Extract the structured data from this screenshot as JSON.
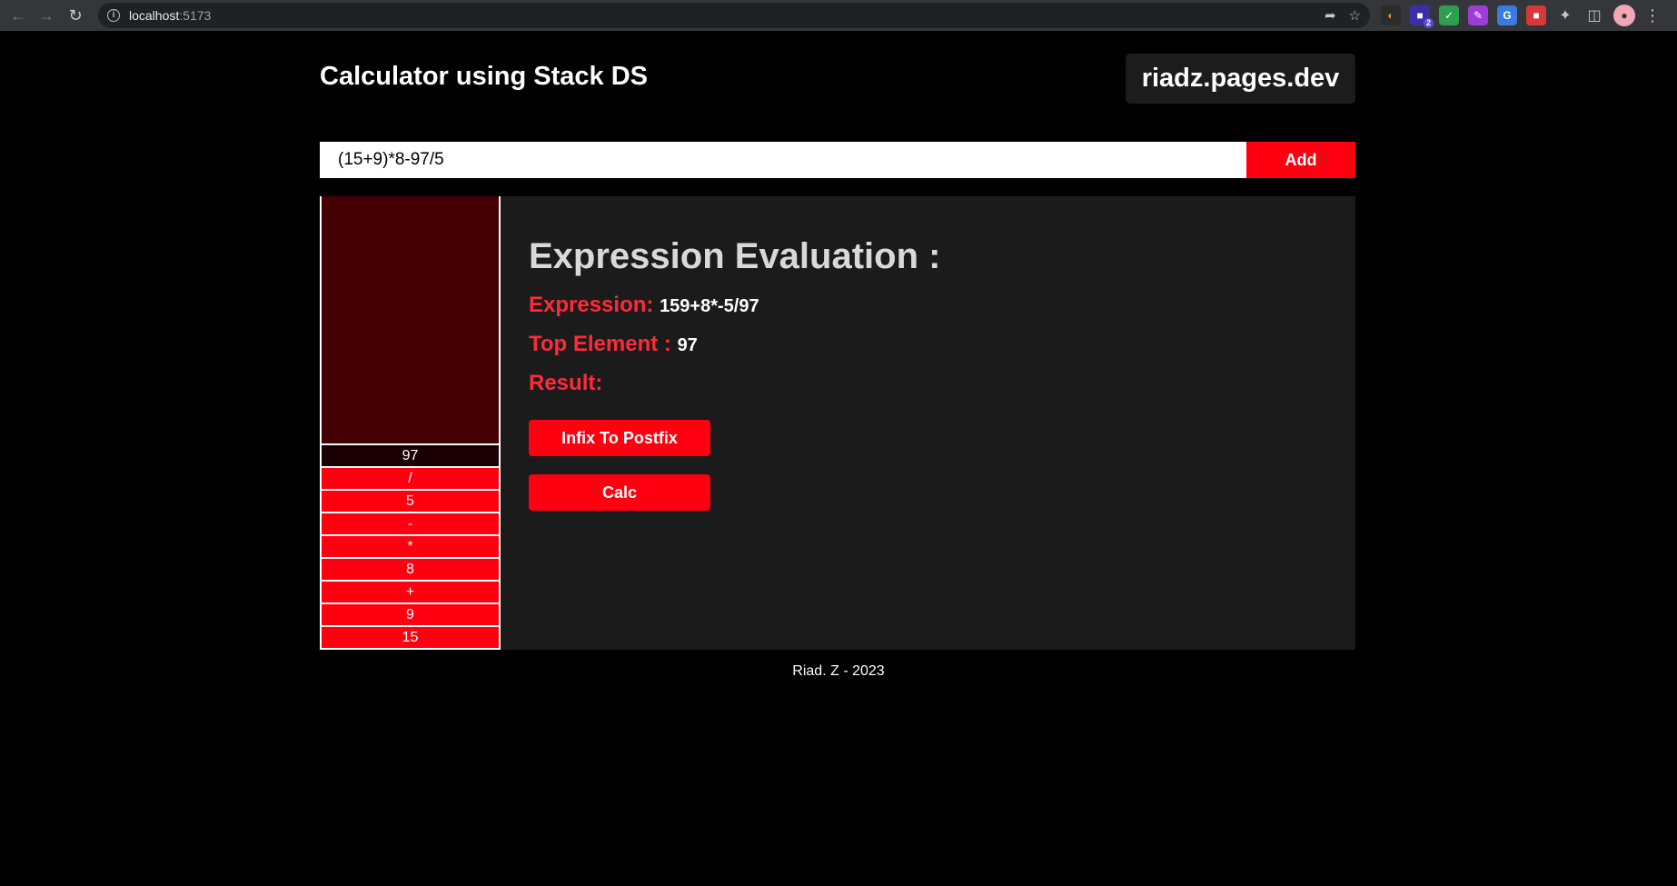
{
  "browser": {
    "url_host": "localhost",
    "url_port": ":5173",
    "extension_badge": "2"
  },
  "header": {
    "title": "Calculator using Stack DS",
    "site_link": "riadz.pages.dev"
  },
  "input": {
    "value": "(15+9)*8-97/5",
    "add_label": "Add"
  },
  "stack": {
    "items": [
      "97",
      "/",
      "5",
      "-",
      "*",
      "8",
      "+",
      "9",
      "15"
    ]
  },
  "evaluation": {
    "heading": "Expression Evaluation :",
    "expression_label": "Expression:",
    "expression_value": "159+8*-5/97",
    "top_label": "Top Element :",
    "top_value": "97",
    "result_label": "Result:",
    "result_value": "",
    "postfix_button": "Infix To Postfix",
    "calc_button": "Calc"
  },
  "footer": {
    "text": "Riad. Z - 2023"
  },
  "colors": {
    "accent": "#ff0010",
    "label_red": "#ff2a3a",
    "stack_bg": "#440003",
    "panel_bg": "#1b1b1b"
  }
}
